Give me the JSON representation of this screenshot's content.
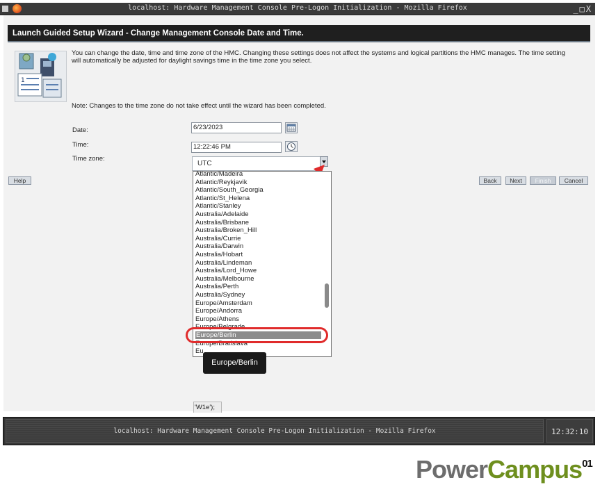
{
  "window": {
    "title": "localhost: Hardware Management Console Pre-Logon Initialization - Mozilla Firefox",
    "controls": "_□X"
  },
  "wizard": {
    "header": "Launch Guided Setup Wizard - Change Management Console Date and Time.",
    "intro": "You can change the date, time and time zone of the HMC. Changing these settings does not affect the systems and logical partitions the HMC manages. The time setting will automatically be adjusted for daylight savings time in the time zone you select.",
    "note": "Note: Changes to the time zone do not take effect until the wizard has been completed.",
    "date_label": "Date:",
    "date_value": "6/23/2023",
    "time_label": "Time:",
    "time_value": "12:22:46 PM",
    "timezone_label": "Time zone:",
    "timezone_value": "UTC"
  },
  "buttons": {
    "help": "Help",
    "back": "Back",
    "next": "Next",
    "finish": "Finish",
    "cancel": "Cancel"
  },
  "timezone_list": {
    "items": [
      "Atlantic/Madeira",
      "Atlantic/Reykjavik",
      "Atlantic/South_Georgia",
      "Atlantic/St_Helena",
      "Atlantic/Stanley",
      "Australia/Adelaide",
      "Australia/Brisbane",
      "Australia/Broken_Hill",
      "Australia/Currie",
      "Australia/Darwin",
      "Australia/Hobart",
      "Australia/Lindeman",
      "Australia/Lord_Howe",
      "Australia/Melbourne",
      "Australia/Perth",
      "Australia/Sydney",
      "Europe/Amsterdam",
      "Europe/Andorra",
      "Europe/Athens",
      "Europe/Belgrade",
      "Europe/Berlin",
      "Europe/Bratislava",
      "Eu"
    ],
    "selected": "Europe/Berlin"
  },
  "tooltip": "Europe/Berlin",
  "status_fragment": "'W1e');",
  "taskbar": {
    "app_title": "localhost: Hardware Management Console Pre-Logon Initialization - Mozilla Firefox",
    "clock": "12:32:10"
  },
  "brand": {
    "part1": "Power",
    "part2": "Campus",
    "sup": "01",
    "color_gray": "#6d6d6d",
    "color_green": "#6e8f1e"
  },
  "colors": {
    "highlight_ring": "#e02b2b",
    "arrow": "#e02b2b",
    "selection": "#8c8c8c"
  }
}
